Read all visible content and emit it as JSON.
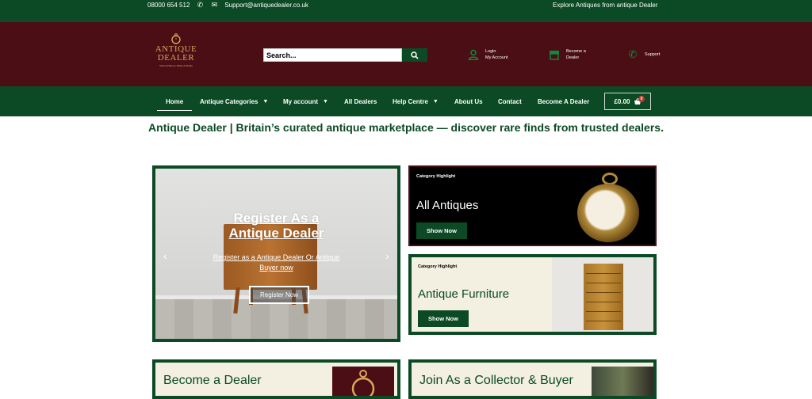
{
  "topbar": {
    "phone": "08000 654 512",
    "email": "Support@antiquedealer.co.uk",
    "right_text": "Explore Antiques from antique Dealer"
  },
  "header": {
    "logo_word1": "ANTIQUE",
    "logo_word2": "DEALER",
    "logo_tagline": "Where History Finds A Home",
    "search_placeholder": "Search...",
    "login_line1": "Login",
    "login_line2": "My Account",
    "dealer_line1": "Become a",
    "dealer_line2": "Dealer",
    "support_label": "Support"
  },
  "nav": {
    "items": [
      {
        "label": "Home",
        "dropdown": false
      },
      {
        "label": "Antique Categories",
        "dropdown": true
      },
      {
        "label": "My account",
        "dropdown": true
      },
      {
        "label": "All Dealers",
        "dropdown": false
      },
      {
        "label": "Help Centre",
        "dropdown": true
      },
      {
        "label": "About Us",
        "dropdown": false
      },
      {
        "label": "Contact",
        "dropdown": false
      },
      {
        "label": "Become A Dealer",
        "dropdown": false
      }
    ],
    "cart_total": "£0.00",
    "cart_count": "0"
  },
  "tagline": "Antique Dealer | Britain’s curated antique marketplace — discover rare finds from trusted dealers.",
  "hero": {
    "title_line1": "Register As a",
    "title_line2": "Antique Dealer",
    "subtitle": "Register as a Antique Dealer Or Antique Buyer now",
    "button": "Register Now"
  },
  "cards": [
    {
      "kicker": "Category Highlight",
      "title": "All Antiques",
      "button": "Show Now"
    },
    {
      "kicker": "Category Highlight",
      "title": "Antique Furniture",
      "button": "Show Now"
    }
  ],
  "bottom_cards": [
    {
      "title": "Become a Dealer"
    },
    {
      "title": "Join As a Collector & Buyer"
    }
  ],
  "colors": {
    "brand_green": "#0b4a24",
    "header_maroon": "#4a0e14",
    "cream": "#f3efe1"
  }
}
